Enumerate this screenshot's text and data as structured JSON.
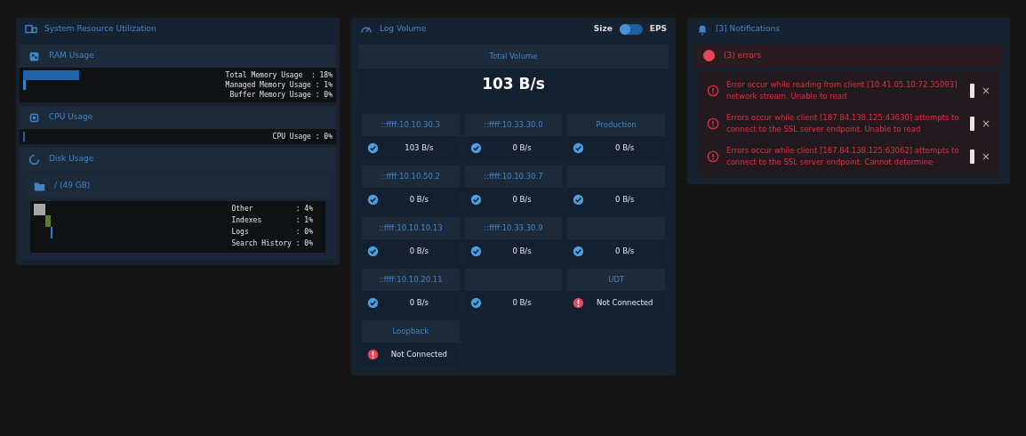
{
  "resources": {
    "title": "System Resource Utilization",
    "ram": {
      "title": "RAM Usage",
      "items": [
        {
          "text": "Total Memory Usage  : 18%",
          "level": 0.18
        },
        {
          "text": "Managed Memory Usage : 1%",
          "level": 0.01
        },
        {
          "text": "Buffer Memory Usage : 0%"
        }
      ]
    },
    "cpu": {
      "title": "CPU Usage",
      "items": [
        {
          "text": "CPU Usage : 0%",
          "level": 0.005
        }
      ]
    },
    "disk": {
      "title": "Disk Usage",
      "volume": "/ (49 GB)",
      "items": [
        {
          "text": "Other          : 4%",
          "level": 0.04,
          "color": "#a8a8a8"
        },
        {
          "text": "Indexes        : 1%",
          "level": 0.02,
          "color": "#5b7d2b"
        },
        {
          "text": "Logs           : 0%",
          "color": "#2f80c8"
        },
        {
          "text": "Search History : 0%"
        }
      ]
    }
  },
  "log_volume": {
    "title": "Log Volume",
    "toggle": {
      "left": "Size",
      "right": "EPS",
      "on": false
    },
    "total": {
      "label": "Total Volume",
      "value": "103 B/s"
    },
    "sources": [
      {
        "name": "::ffff:10.10.30.3",
        "kind": "ok",
        "value": "103 B/s"
      },
      {
        "name": "::ffff:10.33.30.0",
        "kind": "ok",
        "value": "0 B/s"
      },
      {
        "name": "Production",
        "kind": "ok",
        "value": "0 B/s"
      },
      {
        "name": "::ffff:10.10.50.2",
        "kind": "ok",
        "value": "0 B/s"
      },
      {
        "name": "::ffff:10.10.30.7",
        "kind": "ok",
        "value": "0 B/s"
      },
      {
        "kind": "ok",
        "value": "0 B/s"
      },
      {
        "name": "::ffff:10.10.10.13",
        "kind": "ok",
        "value": "0 B/s"
      },
      {
        "name": "::ffff:10.33.30.9",
        "kind": "ok",
        "value": "0 B/s"
      },
      {
        "kind": "ok",
        "value": "0 B/s"
      },
      {
        "name": "::ffff:10.10.20.11",
        "kind": "ok",
        "value": "0 B/s"
      },
      {
        "kind": "ok",
        "value": "0 B/s"
      },
      {
        "name": "UDT",
        "kind": "error",
        "value": "Not Connected"
      },
      {
        "name": "Loopback",
        "kind": "error",
        "value": "Not Connected"
      }
    ]
  },
  "notifications": {
    "title": "[3] Notifications",
    "group": "(3) errors",
    "items": [
      {
        "text": "Error occur while reading from client [10.41.05.10:72.35093] network stream. Unable to read",
        "close": "×"
      },
      {
        "text": "Errors occur while client [187.84.138.125:43630] attempts to connect to the SSL server endpoint. Unable to read",
        "close": "×"
      },
      {
        "text": "Errors occur while client [187.84.138.125:63062] attempts to connect to the SSL server endpoint. Cannot determine",
        "close": "×"
      }
    ]
  }
}
